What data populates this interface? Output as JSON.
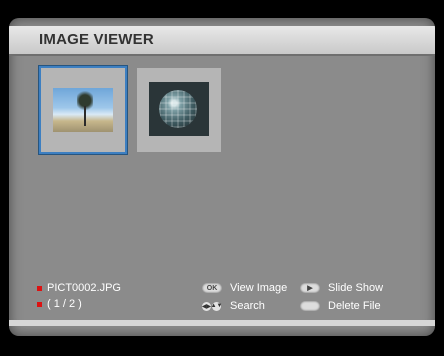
{
  "header": {
    "title": "IMAGE VIEWER"
  },
  "thumbnails": [
    {
      "name": "thumb-1",
      "selected": true
    },
    {
      "name": "thumb-2",
      "selected": false
    }
  ],
  "file": {
    "name": "PICT0002.JPG",
    "index": "( 1 / 2 )"
  },
  "legend": {
    "ok_badge": "OK",
    "view_image": "View Image",
    "search": "Search",
    "slide_show": "Slide Show",
    "delete_file": "Delete File"
  },
  "colors": {
    "selection": "#3d7fc1",
    "bullet": "#dd1111"
  }
}
